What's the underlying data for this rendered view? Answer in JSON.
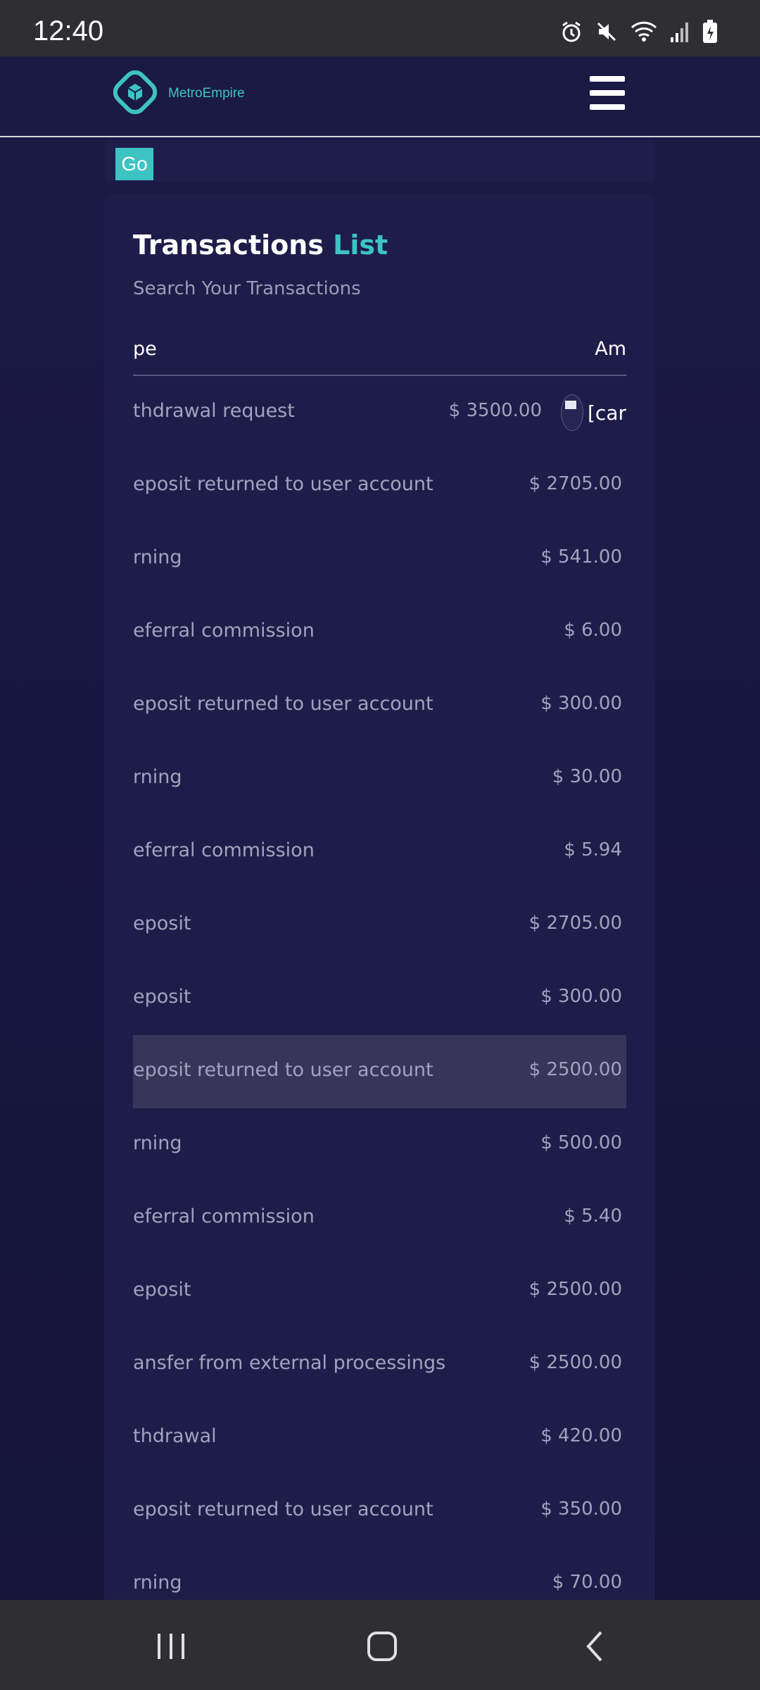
{
  "status_bar": {
    "time": "12:40",
    "icons": [
      "alarm-icon",
      "mute-icon",
      "wifi-icon",
      "signal-icon",
      "battery-icon"
    ]
  },
  "header": {
    "brand": "MetroEmpire",
    "menu_icon": "hamburger-menu-icon"
  },
  "search": {
    "go_label": "Go"
  },
  "card": {
    "title_main": "Transactions",
    "title_accent": "List",
    "subtitle": "Search Your Transactions"
  },
  "table": {
    "columns": [
      "pe",
      "Am"
    ],
    "rows": [
      {
        "type": "thdrawal request",
        "amount": "$ 3500.00",
        "extra": "[car"
      },
      {
        "type": "eposit returned to user account",
        "amount": "$ 2705.00"
      },
      {
        "type": "rning",
        "amount": "$ 541.00"
      },
      {
        "type": "eferral commission",
        "amount": "$ 6.00"
      },
      {
        "type": "eposit returned to user account",
        "amount": "$ 300.00"
      },
      {
        "type": "rning",
        "amount": "$ 30.00"
      },
      {
        "type": "eferral commission",
        "amount": "$ 5.94"
      },
      {
        "type": "eposit",
        "amount": "$ 2705.00"
      },
      {
        "type": "eposit",
        "amount": "$ 300.00"
      },
      {
        "type": "eposit returned to user account",
        "amount": "$ 2500.00"
      },
      {
        "type": "rning",
        "amount": "$ 500.00"
      },
      {
        "type": "eferral commission",
        "amount": "$ 5.40"
      },
      {
        "type": "eposit",
        "amount": "$ 2500.00"
      },
      {
        "type": "ansfer from external processings",
        "amount": "$ 2500.00"
      },
      {
        "type": "thdrawal",
        "amount": "$ 420.00"
      },
      {
        "type": "eposit returned to user account",
        "amount": "$ 350.00"
      },
      {
        "type": "rning",
        "amount": "$ 70.00"
      }
    ]
  },
  "colors": {
    "accent": "#3ec3c3",
    "background": "#17163c",
    "card": "#1e1d4a",
    "highlight_row": "#37365a"
  },
  "nav": {
    "recents_icon": "recents-icon",
    "home_icon": "home-icon",
    "back_icon": "back-icon"
  }
}
